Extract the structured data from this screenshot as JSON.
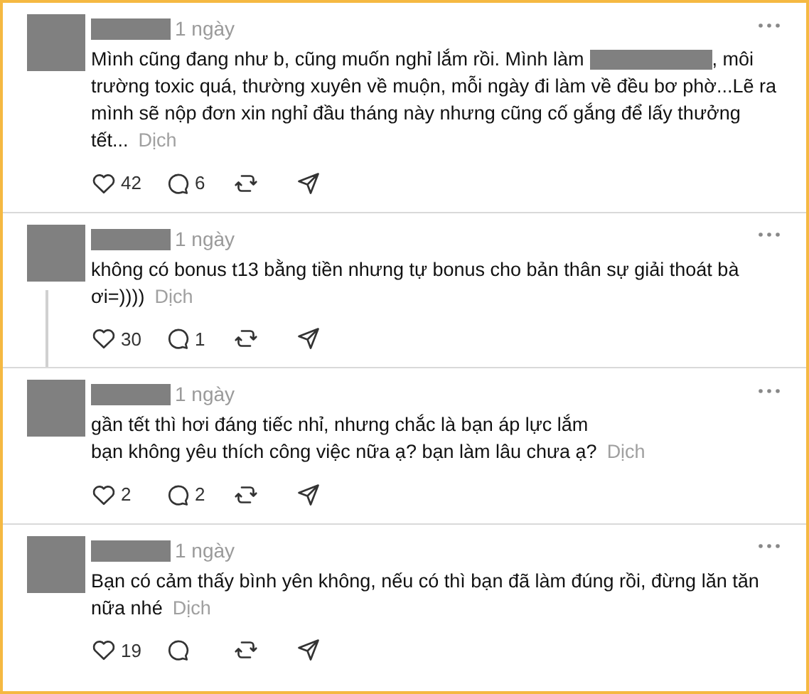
{
  "posts": [
    {
      "time": "1 ngày",
      "thread_line": false,
      "lines": [
        {
          "text": "Mình cũng đang như b, cũng muốn nghỉ lắm rồi. Mình làm",
          "redacted": true,
          "text_after": ", môi"
        },
        {
          "text": "trường toxic quá, thường xuyên về muộn, mỗi ngày đi làm về đều bơ phờ...Lẽ ra",
          "redacted": false
        },
        {
          "text": "mình sẽ nộp đơn xin nghỉ đầu tháng này nhưng cũng cố gắng để lấy thưởng",
          "redacted": false
        },
        {
          "text": "tết...",
          "redacted": false
        }
      ],
      "translate": "Dịch",
      "likes": "42",
      "replies": "6"
    },
    {
      "time": "1 ngày",
      "thread_line": true,
      "lines": [
        {
          "text": "không có bonus t13 bằng tiền nhưng tự bonus cho bản thân sự giải thoát bà",
          "redacted": false
        },
        {
          "text": "ơi=))))",
          "redacted": false
        }
      ],
      "translate": "Dịch",
      "likes": "30",
      "replies": "1"
    },
    {
      "time": "1 ngày",
      "thread_line": false,
      "lines": [
        {
          "text": "gần tết thì hơi đáng tiếc nhỉ, nhưng chắc là bạn áp lực lắm",
          "redacted": false
        },
        {
          "text": "bạn không yêu thích công việc nữa ạ? bạn làm lâu chưa ạ?",
          "redacted": false
        }
      ],
      "translate": "Dịch",
      "likes": "2",
      "replies": "2"
    },
    {
      "time": "1 ngày",
      "thread_line": false,
      "lines": [
        {
          "text": "Bạn có cảm thấy bình yên không, nếu có thì bạn đã làm đúng rồi, đừng lăn tăn",
          "redacted": false
        },
        {
          "text": "nữa nhé",
          "redacted": false
        }
      ],
      "translate": "Dịch",
      "likes": "19"
    }
  ]
}
